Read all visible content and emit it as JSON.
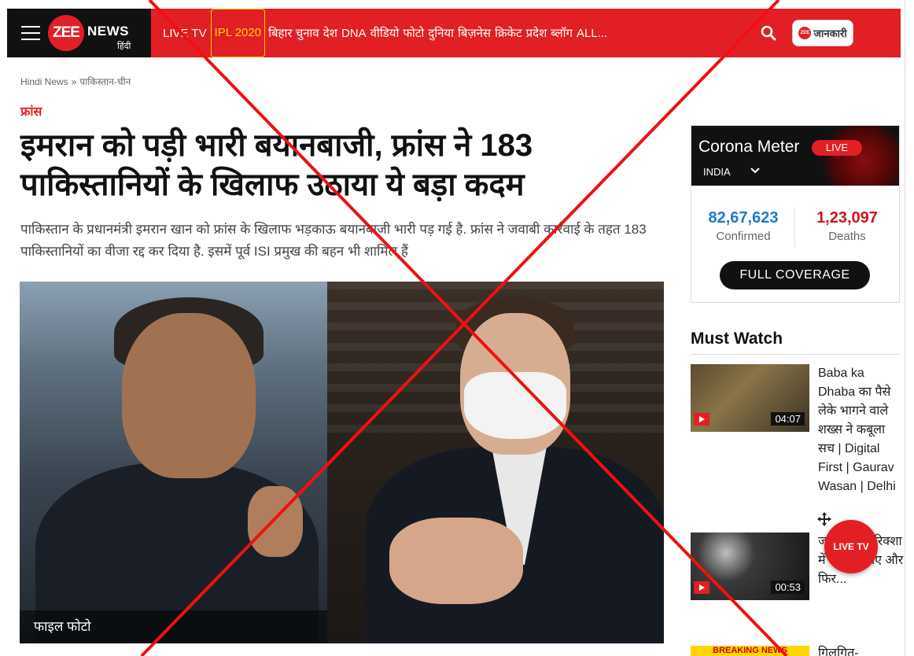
{
  "header": {
    "logo_zee": "ZEE",
    "logo_news": "NEWS",
    "logo_hindi": "हिंदी",
    "nav_items": [
      "LIVE TV",
      "IPL 2020",
      "बिहार चुनाव",
      "देश",
      "DNA",
      "वीडियो",
      "फोटो",
      "दुनिया",
      "बिज़नेस",
      "क्रिकेट",
      "प्रदेश",
      "ब्लॉग",
      "ALL..."
    ],
    "jaankari_label": "जानकारी",
    "jaankari_badge": "ZEE",
    "colors": {
      "brand_red": "#e11f25",
      "ipl_highlight": "#ffd400"
    }
  },
  "breadcrumb": {
    "home": "Hindi News",
    "separator": "»",
    "section": "पाकिस्तान-चीन"
  },
  "article": {
    "category": "फ्रांस",
    "title": "इमरान को पड़ी भारी बयानबाजी, फ्रांस ने 183 पाकिस्तानियों के खिलाफ उठाया ये बड़ा कदम",
    "summary": "पाकिस्तान के प्रधानमंत्री इमरान खान को फ्रांस के खिलाफ भड़काऊ बयानबाजी भारी पड़ गई है. फ्रांस ने जवाबी कार्रवाई के तहत 183 पाकिस्तानियों का वीजा रद्द कर दिया है. इसमें पूर्व ISI प्रमुख की बहन भी शामिल हैं",
    "image_caption": "फाइल फोटो"
  },
  "corona": {
    "title": "Corona Meter",
    "live": "LIVE",
    "country": "INDIA",
    "confirmed_value": "82,67,623",
    "confirmed_label": "Confirmed",
    "deaths_value": "1,23,097",
    "deaths_label": "Deaths",
    "button": "FULL COVERAGE",
    "colors": {
      "confirmed": "#1f7ac9",
      "deaths": "#d0141a"
    }
  },
  "must_watch": {
    "title": "Must Watch",
    "videos": [
      {
        "duration": "04:07",
        "text": "Baba ka Dhaba का पैसे लेके भागने वाले शख्स ने कबूला सच | Digital First | Gaurav Wasan | Delhi"
      },
      {
        "duration": "00:53",
        "text": "ज... न लू... रिक्शा में बैठकर आए और फिर..."
      }
    ],
    "breaking_label": "BREAKING NEWS",
    "next_item_text": "गिलगित-"
  },
  "floating": {
    "live_tv": "LIVE TV"
  }
}
